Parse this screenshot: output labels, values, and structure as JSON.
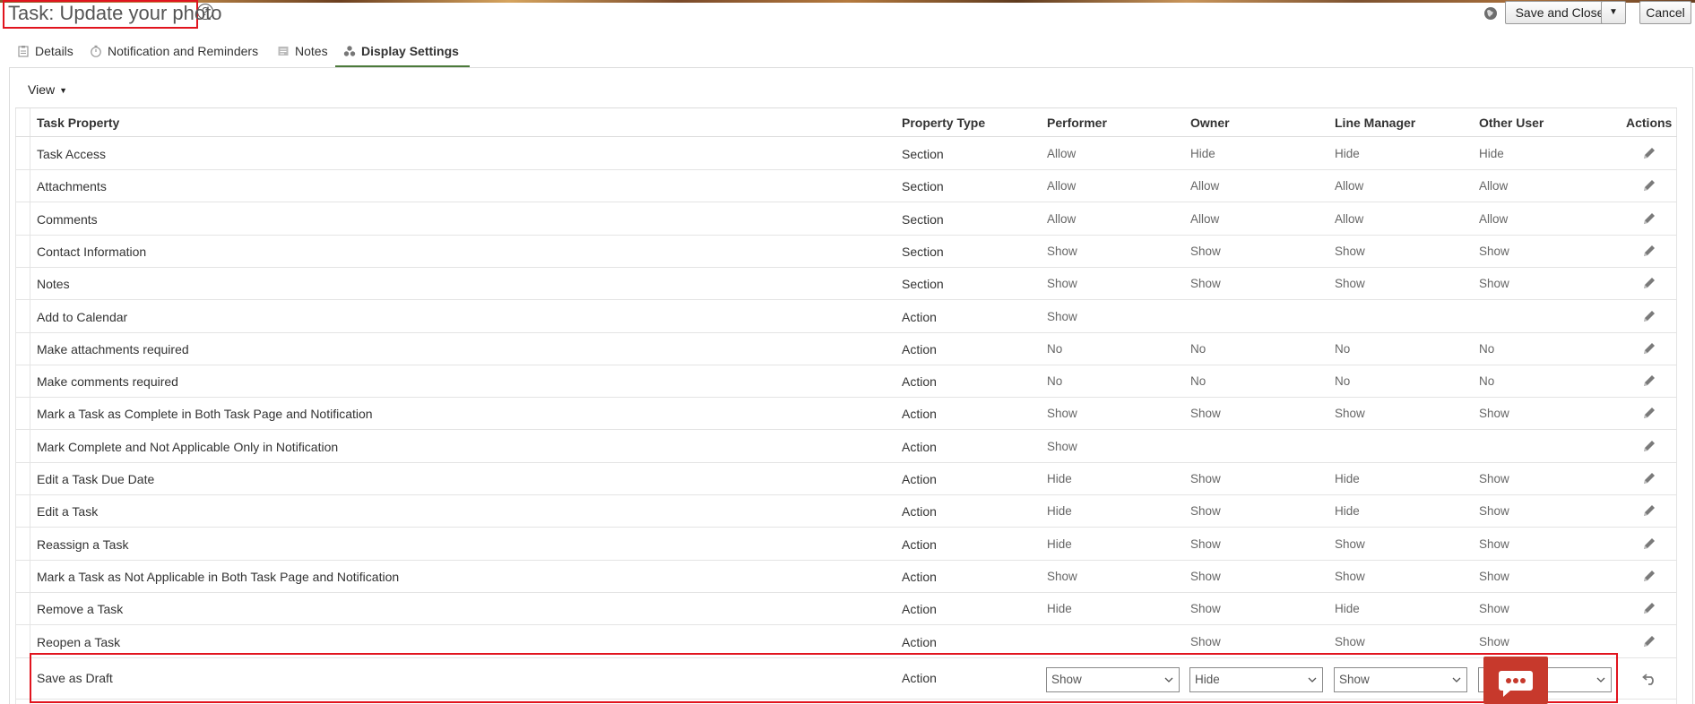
{
  "header": {
    "title": "Task: Update your photo",
    "help_icon": "help-icon",
    "help_glyph": "?",
    "save_close_label": "Save and Close",
    "save_menu_glyph": "▼",
    "cancel_label": "Cancel"
  },
  "tabs": [
    {
      "label": "Details",
      "icon": "clipboard-icon"
    },
    {
      "label": "Notification and Reminders",
      "icon": "timer-icon"
    },
    {
      "label": "Notes",
      "icon": "note-icon"
    },
    {
      "label": "Display Settings",
      "icon": "cluster-icon",
      "selected": true
    }
  ],
  "view_menu": {
    "label": "View",
    "caret": "▼"
  },
  "table": {
    "columns": [
      "Task Property",
      "Property Type",
      "Performer",
      "Owner",
      "Line Manager",
      "Other User",
      "Actions"
    ],
    "rows": [
      {
        "property": "Task Access",
        "type": "Section",
        "performer": "Allow",
        "owner": "Hide",
        "line_manager": "Hide",
        "other_user": "Hide"
      },
      {
        "property": "Attachments",
        "type": "Section",
        "performer": "Allow",
        "owner": "Allow",
        "line_manager": "Allow",
        "other_user": "Allow"
      },
      {
        "property": "Comments",
        "type": "Section",
        "performer": "Allow",
        "owner": "Allow",
        "line_manager": "Allow",
        "other_user": "Allow"
      },
      {
        "property": "Contact Information",
        "type": "Section",
        "performer": "Show",
        "owner": "Show",
        "line_manager": "Show",
        "other_user": "Show"
      },
      {
        "property": "Notes",
        "type": "Section",
        "performer": "Show",
        "owner": "Show",
        "line_manager": "Show",
        "other_user": "Show"
      },
      {
        "property": "Add to Calendar",
        "type": "Action",
        "performer": "Show",
        "owner": "",
        "line_manager": "",
        "other_user": ""
      },
      {
        "property": "Make attachments required",
        "type": "Action",
        "performer": "No",
        "owner": "No",
        "line_manager": "No",
        "other_user": "No"
      },
      {
        "property": "Make comments required",
        "type": "Action",
        "performer": "No",
        "owner": "No",
        "line_manager": "No",
        "other_user": "No"
      },
      {
        "property": "Mark a Task as Complete in Both Task Page and Notification",
        "type": "Action",
        "performer": "Show",
        "owner": "Show",
        "line_manager": "Show",
        "other_user": "Show"
      },
      {
        "property": "Mark Complete and Not Applicable Only in Notification",
        "type": "Action",
        "performer": "Show",
        "owner": "",
        "line_manager": "",
        "other_user": ""
      },
      {
        "property": "Edit a Task Due Date",
        "type": "Action",
        "performer": "Hide",
        "owner": "Show",
        "line_manager": "Hide",
        "other_user": "Show"
      },
      {
        "property": "Edit a Task",
        "type": "Action",
        "performer": "Hide",
        "owner": "Show",
        "line_manager": "Hide",
        "other_user": "Show"
      },
      {
        "property": "Reassign a Task",
        "type": "Action",
        "performer": "Hide",
        "owner": "Show",
        "line_manager": "Show",
        "other_user": "Show"
      },
      {
        "property": "Mark a Task as Not Applicable in Both Task Page and Notification",
        "type": "Action",
        "performer": "Show",
        "owner": "Show",
        "line_manager": "Show",
        "other_user": "Show"
      },
      {
        "property": "Remove a Task",
        "type": "Action",
        "performer": "Hide",
        "owner": "Show",
        "line_manager": "Hide",
        "other_user": "Show"
      },
      {
        "property": "Reopen a Task",
        "type": "Action",
        "performer": "",
        "owner": "Show",
        "line_manager": "Show",
        "other_user": "Show"
      }
    ],
    "edit_row": {
      "property": "Save as Draft",
      "type": "Action",
      "performer": "Show",
      "owner": "Hide",
      "line_manager": "Show",
      "other_user": ""
    }
  },
  "icons": {
    "row_action": "pencil-icon",
    "edit_row_action": "undo-icon",
    "chat": "chat-icon"
  },
  "colors": {
    "highlight": "#e1141e",
    "tab_underline": "#4b7a3a",
    "chat_button": "#c7392c"
  }
}
